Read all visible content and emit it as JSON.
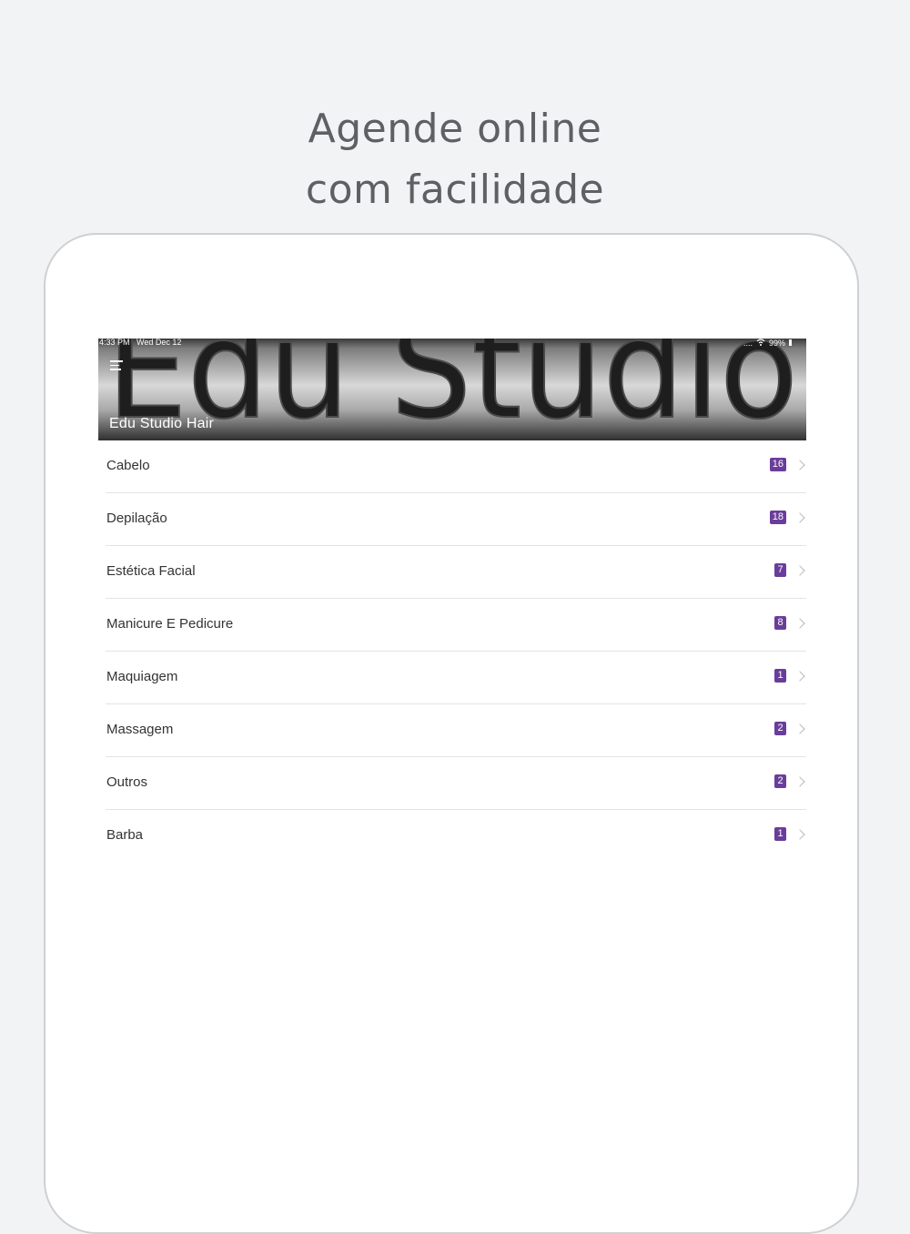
{
  "promo": {
    "headline_line1": "Agende online",
    "headline_line2": "com facilidade"
  },
  "status_bar": {
    "time": "4:33 PM",
    "date": "Wed Dec 12",
    "signal": "....",
    "battery": "99%"
  },
  "header": {
    "brand_art_text": "Edu Studio",
    "shop_name": "Edu Studio Hair",
    "menu_icon": "hamburger-menu-icon"
  },
  "categories": [
    {
      "label": "Cabelo",
      "count": "16"
    },
    {
      "label": "Depilação",
      "count": "18"
    },
    {
      "label": "Estética Facial",
      "count": "7"
    },
    {
      "label": "Manicure E Pedicure",
      "count": "8"
    },
    {
      "label": "Maquiagem",
      "count": "1"
    },
    {
      "label": "Massagem",
      "count": "2"
    },
    {
      "label": "Outros",
      "count": "2"
    },
    {
      "label": "Barba",
      "count": "1"
    }
  ],
  "colors": {
    "background": "#f2f3f5",
    "badge": "#6a3d9a",
    "headline_text": "#5f6063",
    "row_text": "#333333"
  }
}
